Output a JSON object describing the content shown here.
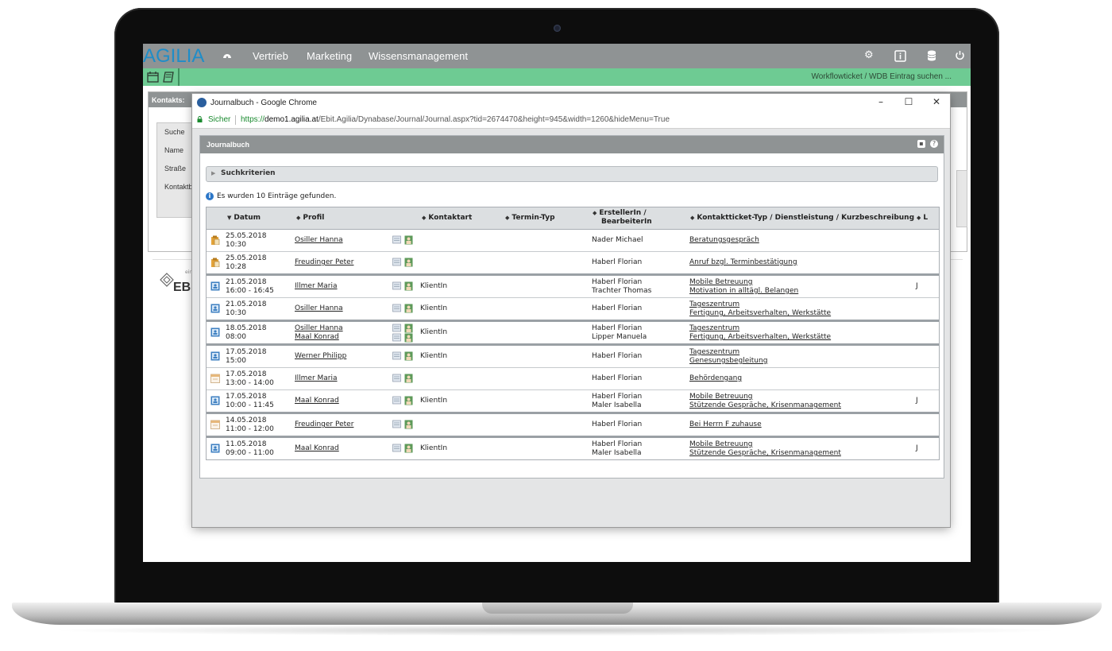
{
  "app": {
    "logo": "AGILIA",
    "nav": [
      "Vertrieb",
      "Marketing",
      "Wissensmanagement"
    ],
    "workflow_search": "Workflowticket / WDB Eintrag suchen ...",
    "icons": [
      "dashboard-icon",
      "gear-icon",
      "info-icon",
      "database-icon",
      "power-icon",
      "calendar-icon",
      "book-icon"
    ]
  },
  "background_page": {
    "panel_title": "Kontakts:",
    "fields": [
      "Suche",
      "Name",
      "Straße",
      "Kontaktb"
    ],
    "footer_small": "ein",
    "footer_logo": "EBI"
  },
  "chrome": {
    "window_title": "Journalbuch - Google Chrome",
    "secure_label": "Sicher",
    "url_proto": "https://",
    "url_host": "demo1.agilia.at",
    "url_path": "/Ebit.Agilia/Dynabase/Journal/Journal.aspx?tid=2674470&height=945&width=1260&hideMenu=True",
    "buttons": [
      "–",
      "☐",
      "✕"
    ]
  },
  "journal": {
    "title": "Journalbuch",
    "search_criteria": "Suchkriterien",
    "found_text": "Es wurden 10 Einträge gefunden.",
    "columns": {
      "datum": "Datum",
      "profil": "Profil",
      "kontaktart": "Kontaktart",
      "termin_typ": "Termin-Typ",
      "ersteller_1": "ErstellerIn /",
      "ersteller_2": "BearbeiterIn",
      "ticket_typ": "Kontaktticket-Typ / Dienstleistung / Kurzbeschreibung",
      "l": "L"
    },
    "rows": [
      {
        "d1": "25.05.2018",
        "d2": "10:30",
        "p1": "Osiller Hanna",
        "p2": "",
        "kontaktart": "",
        "e1": "Nader Michael",
        "e2": "",
        "k1": "Beratungsgespräch",
        "k2": "",
        "l": ""
      },
      {
        "d1": "25.05.2018",
        "d2": "10:28",
        "p1": "Freudinger Peter",
        "p2": "",
        "kontaktart": "",
        "e1": "Haberl Florian",
        "e2": "",
        "k1": "Anruf bzgl. Terminbestätigung",
        "k2": "",
        "l": ""
      },
      {
        "d1": "21.05.2018",
        "d2": "16:00 - 16:45",
        "p1": "Illmer Maria",
        "p2": "",
        "kontaktart": "KlientIn",
        "e1": "Haberl Florian",
        "e2": "Trachter Thomas",
        "k1": "Mobile Betreuung",
        "k2": "Motivation in alltägl. Belangen",
        "l": "J"
      },
      {
        "d1": "21.05.2018",
        "d2": "10:30",
        "p1": "Osiller Hanna",
        "p2": "",
        "kontaktart": "KlientIn",
        "e1": "Haberl Florian",
        "e2": "",
        "k1": "Tageszentrum",
        "k2": "Fertigung, Arbeitsverhalten, Werkstätte",
        "l": ""
      },
      {
        "d1": "18.05.2018",
        "d2": "08:00",
        "p1": "Osiller Hanna",
        "p2": "Maal Konrad",
        "kontaktart": "KlientIn",
        "e1": "Haberl Florian",
        "e2": "Lipper Manuela",
        "k1": "Tageszentrum",
        "k2": "Fertigung, Arbeitsverhalten, Werkstätte",
        "l": ""
      },
      {
        "d1": "17.05.2018",
        "d2": "15:00",
        "p1": "Werner Philipp",
        "p2": "",
        "kontaktart": "KlientIn",
        "e1": "Haberl Florian",
        "e2": "",
        "k1": "Tageszentrum",
        "k2": "Genesungsbegleitung",
        "l": ""
      },
      {
        "d1": "17.05.2018",
        "d2": "13:00 - 14:00",
        "p1": "Illmer Maria",
        "p2": "",
        "kontaktart": "",
        "e1": "Haberl Florian",
        "e2": "",
        "k1": "Behördengang",
        "k2": "",
        "l": ""
      },
      {
        "d1": "17.05.2018",
        "d2": "10:00 - 11:45",
        "p1": "Maal Konrad",
        "p2": "",
        "kontaktart": "KlientIn",
        "e1": "Haberl Florian",
        "e2": "Maler Isabella",
        "k1": "Mobile Betreuung",
        "k2": "Stützende Gespräche, Krisenmanagement",
        "l": "J"
      },
      {
        "d1": "14.05.2018",
        "d2": "11:00 - 12:00",
        "p1": "Freudinger Peter",
        "p2": "",
        "kontaktart": "",
        "e1": "Haberl Florian",
        "e2": "",
        "k1": "Bei Herrn F zuhause",
        "k2": "",
        "l": ""
      },
      {
        "d1": "11.05.2018",
        "d2": "09:00 - 11:00",
        "p1": "Maal Konrad",
        "p2": "",
        "kontaktart": "KlientIn",
        "e1": "Haberl Florian",
        "e2": "Maler Isabella",
        "k1": "Mobile Betreuung",
        "k2": "Stützende Gespräche, Krisenmanagement",
        "l": "J"
      }
    ]
  },
  "colors": {
    "accent_green": "#6ecb93",
    "header_gray": "#8f9394",
    "logo_blue": "#1f8dc8"
  }
}
